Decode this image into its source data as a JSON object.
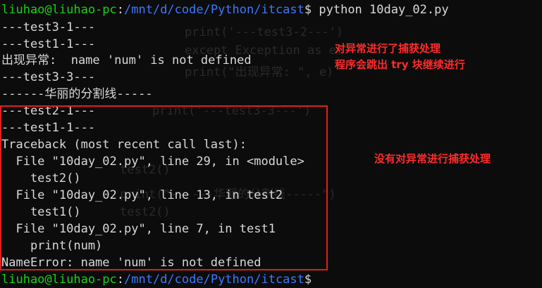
{
  "prompt": {
    "user_host": "liuhao@liuhao-pc",
    "separator": ":",
    "path": "/mnt/d/code/Python/itcast",
    "dollar": "$",
    "command": " python 10day_02.py"
  },
  "output_lines": [
    "---test3-1---",
    "---test1-1---",
    "出现异常:  name 'num' is not defined",
    "---test3-3---",
    "------华丽的分割线-----",
    "---test2-1---",
    "---test1-1---",
    "Traceback (most recent call last):",
    "  File \"10day_02.py\", line 29, in <module>",
    "    test2()",
    "  File \"10day_02.py\", line 13, in test2",
    "    test1()",
    "  File \"10day_02.py\", line 7, in test1",
    "    print(num)",
    "NameError: name 'num' is not defined"
  ],
  "background_code": [
    "print('---test3-2---')",
    "except Exception as e:",
    "print(\"出现异常: \", e)",
    "print('---test3-3---')",
    "test2()",
    "print(\"------华丽的分割线-----\")",
    "test2()"
  ],
  "annotations": {
    "caught_line1": "对异常进行了捕获处理",
    "caught_line2": "程序会跳出 try 块继续进行",
    "uncaught": "没有对异常进行捕获处理"
  },
  "colors": {
    "background": "#0c0c0c",
    "text": "#d9d9d9",
    "prompt_user": "#17d217",
    "prompt_path": "#3b78ff",
    "highlight_box": "#e01e1e",
    "annotation": "#ff2b2b"
  }
}
